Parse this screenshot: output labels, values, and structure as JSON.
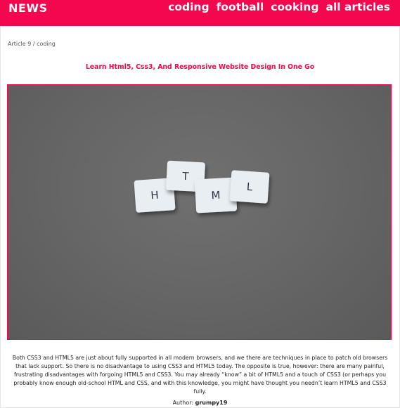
{
  "header": {
    "brand": "NEWS",
    "nav": [
      "coding",
      "football",
      "cooking",
      "all articles"
    ]
  },
  "breadcrumb": {
    "article": "Article 9",
    "separator": "/",
    "category": "coding"
  },
  "article": {
    "title": "Learn Html5, Css3, And Responsive Website Design In One Go",
    "image_tiles": [
      "H",
      "T",
      "M",
      "L"
    ],
    "body": "Both CSS3 and HTML5 are just about fully supported in all modern browsers, and we there are techniques in place to patch old browsers that lack support. So there is no disadvantage to using CSS3 and HTML5 today. The opposite is true, however: there are many painful, frustrating disadvantages with forgoing HTML5 and CSS3. You may already “know” a bit of HTML5 and a touch of CSS3 (or perhaps you probably know enough old-school HTML and CSS, and with this knowledge, you might have thought you needn’t learn HTML5 and CSS3 fully.",
    "author_label": "Author:",
    "author_name": "grumpy19"
  },
  "colors": {
    "accent": "#f3074d",
    "image_background": "#666666",
    "tile": "#e9eef2"
  }
}
